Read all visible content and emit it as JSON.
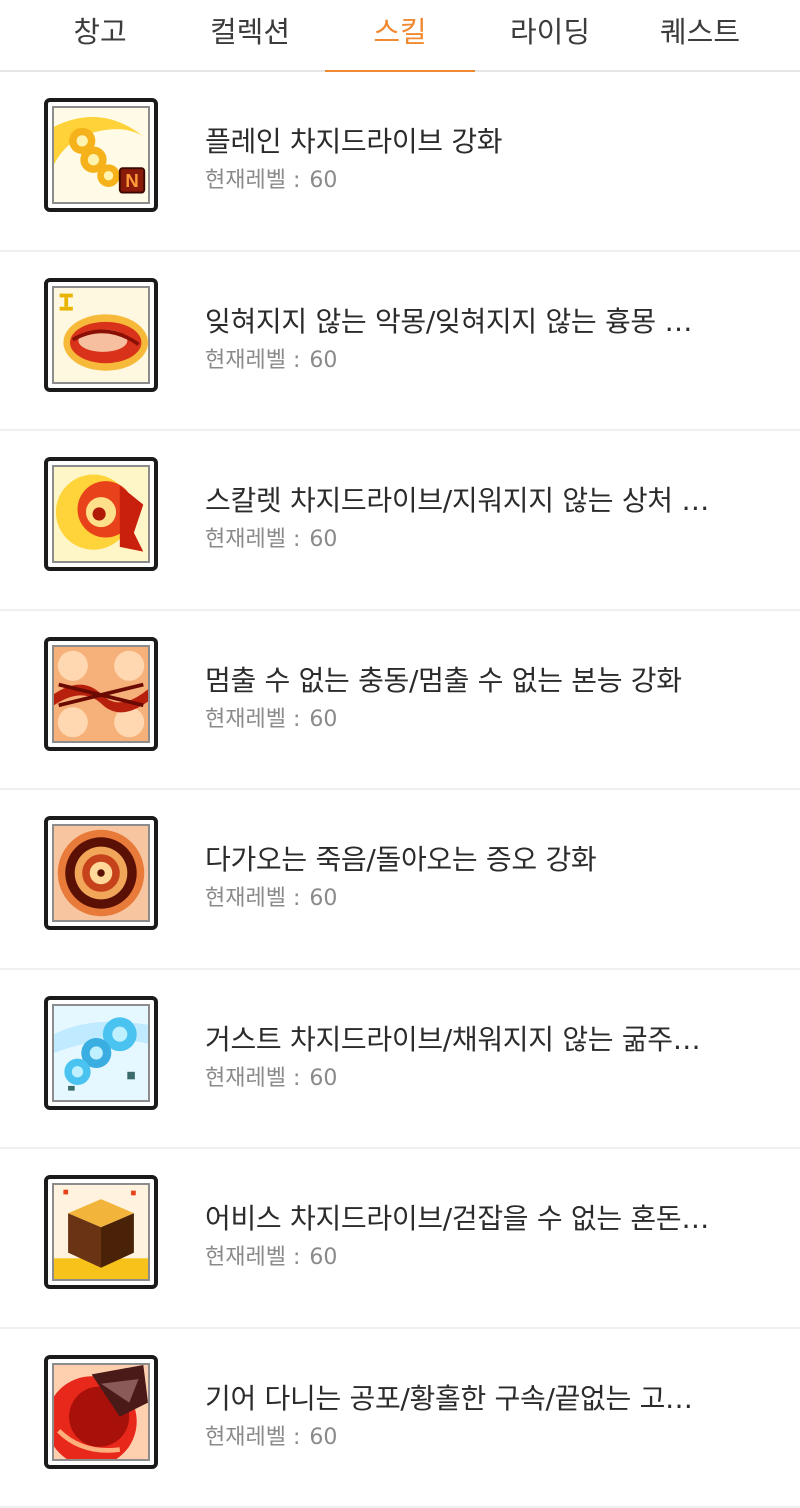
{
  "tabs": [
    {
      "label": "창고",
      "active": false
    },
    {
      "label": "컬렉션",
      "active": false
    },
    {
      "label": "스킬",
      "active": true
    },
    {
      "label": "라이딩",
      "active": false
    },
    {
      "label": "퀘스트",
      "active": false
    }
  ],
  "accent_color": "#f08a32",
  "level_prefix": "현재레벨 :",
  "skills": [
    {
      "name": "플레인 차지드라이브 강화",
      "level": "60",
      "icon": "flame-charge-icon"
    },
    {
      "name": "잊혀지지 않는 악몽/잊혀지지 않는 흉몽 …",
      "level": "60",
      "icon": "nightmare-slash-icon"
    },
    {
      "name": "스칼렛 차지드라이브/지워지지 않는 상처 …",
      "level": "60",
      "icon": "scarlet-charge-icon"
    },
    {
      "name": "멈출 수 없는 충동/멈출 수 없는 본능 강화",
      "level": "60",
      "icon": "impulse-claw-icon"
    },
    {
      "name": "다가오는 죽음/돌아오는 증오 강화",
      "level": "60",
      "icon": "death-orb-icon"
    },
    {
      "name": "거스트 차지드라이브/채워지지 않는 굶주…",
      "level": "60",
      "icon": "gust-charge-icon"
    },
    {
      "name": "어비스 차지드라이브/걷잡을 수 없는 혼돈…",
      "level": "60",
      "icon": "abyss-cube-icon"
    },
    {
      "name": "기어 다니는 공포/황홀한 구속/끝없는 고…",
      "level": "60",
      "icon": "crawling-fear-icon"
    }
  ]
}
